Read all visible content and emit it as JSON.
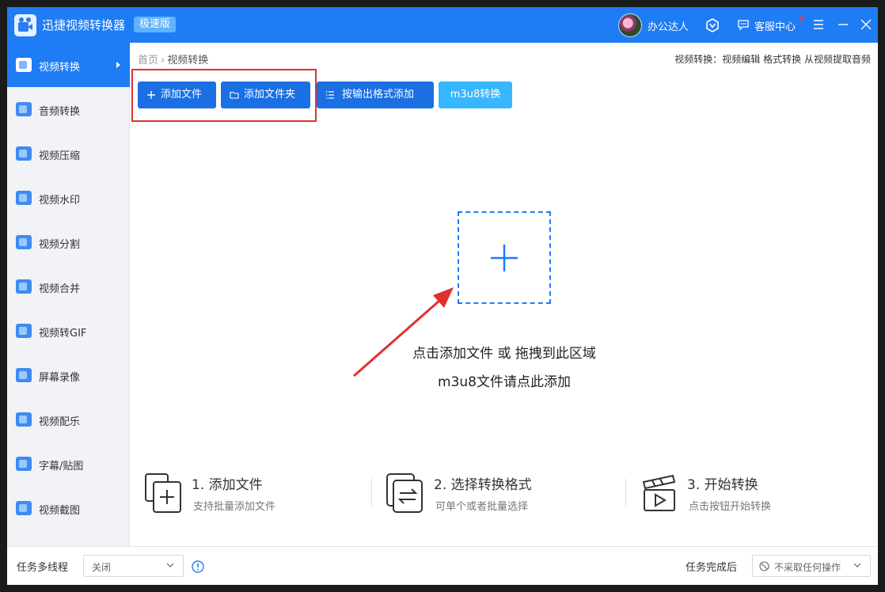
{
  "app": {
    "title": "迅捷视频转换器",
    "edition": "极速版"
  },
  "header": {
    "username": "办公达人",
    "service": "客服中心"
  },
  "sidebar": {
    "items": [
      {
        "label": "视频转换"
      },
      {
        "label": "音频转换"
      },
      {
        "label": "视频压缩"
      },
      {
        "label": "视频水印"
      },
      {
        "label": "视频分割"
      },
      {
        "label": "视频合并"
      },
      {
        "label": "视频转GIF"
      },
      {
        "label": "屏幕录像"
      },
      {
        "label": "视频配乐"
      },
      {
        "label": "字幕/贴图"
      },
      {
        "label": "视频截图"
      }
    ]
  },
  "breadcrumb": {
    "home": "首页",
    "current": "视频转换"
  },
  "quick_links": {
    "prefix": "视频转换：",
    "items": [
      "视频编辑",
      "格式转换",
      "从视频提取音频"
    ]
  },
  "toolbar": {
    "add_file": "添加文件",
    "add_folder": "添加文件夹",
    "add_by_format": "按输出格式添加",
    "m3u8": "m3u8转换"
  },
  "dropzone": {
    "line1": "点击添加文件 或 拖拽到此区域",
    "line2": "m3u8文件请点此添加"
  },
  "steps": [
    {
      "title": "1. 添加文件",
      "desc": "支持批量添加文件"
    },
    {
      "title": "2. 选择转换格式",
      "desc": "可单个或者批量选择"
    },
    {
      "title": "3. 开始转换",
      "desc": "点击按钮开始转换"
    }
  ],
  "bottom": {
    "multithread_label": "任务多线程",
    "multithread_value": "关闭",
    "after_label": "任务完成后",
    "after_value": "不采取任何操作"
  },
  "colors": {
    "primary": "#1e7cf5",
    "button": "#1a6fe3",
    "m3u8_button": "#38b6ff",
    "highlight": "#e03131"
  }
}
